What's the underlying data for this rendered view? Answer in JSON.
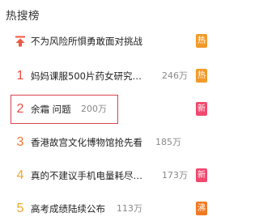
{
  "panel": {
    "title": "热搜榜",
    "items": [
      {
        "rank": "",
        "text": "不为风险所惧勇敢面对挑战",
        "count": "",
        "badge": "热",
        "badge_color": "#f19a29",
        "rank_color": ""
      },
      {
        "rank": "1",
        "text": "妈妈课服500片药女研究…",
        "count": "246万",
        "badge": "热",
        "badge_color": "#f19a29",
        "rank_color": "#f04a43"
      },
      {
        "rank": "2",
        "text": "余霜 问题",
        "count": "200万",
        "badge": "新",
        "badge_color": "#f0486e",
        "rank_color": "#f04a43"
      },
      {
        "rank": "3",
        "text": "香港故宫文化博物馆抢先看",
        "count": "185万",
        "badge": "",
        "badge_color": "",
        "rank_color": "#f57634"
      },
      {
        "rank": "4",
        "text": "真的不建议手机电量耗尽…",
        "count": "173万",
        "badge": "新",
        "badge_color": "#f0486e",
        "rank_color": "#f0a62f"
      },
      {
        "rank": "5",
        "text": "高考成绩陆续公布",
        "count": "113万",
        "badge": "沸",
        "badge_color": "#f07a22",
        "rank_color": "#f0a62f"
      }
    ]
  },
  "colors": {
    "pin": "#f0573f",
    "highlight_border": "#d9434b"
  }
}
